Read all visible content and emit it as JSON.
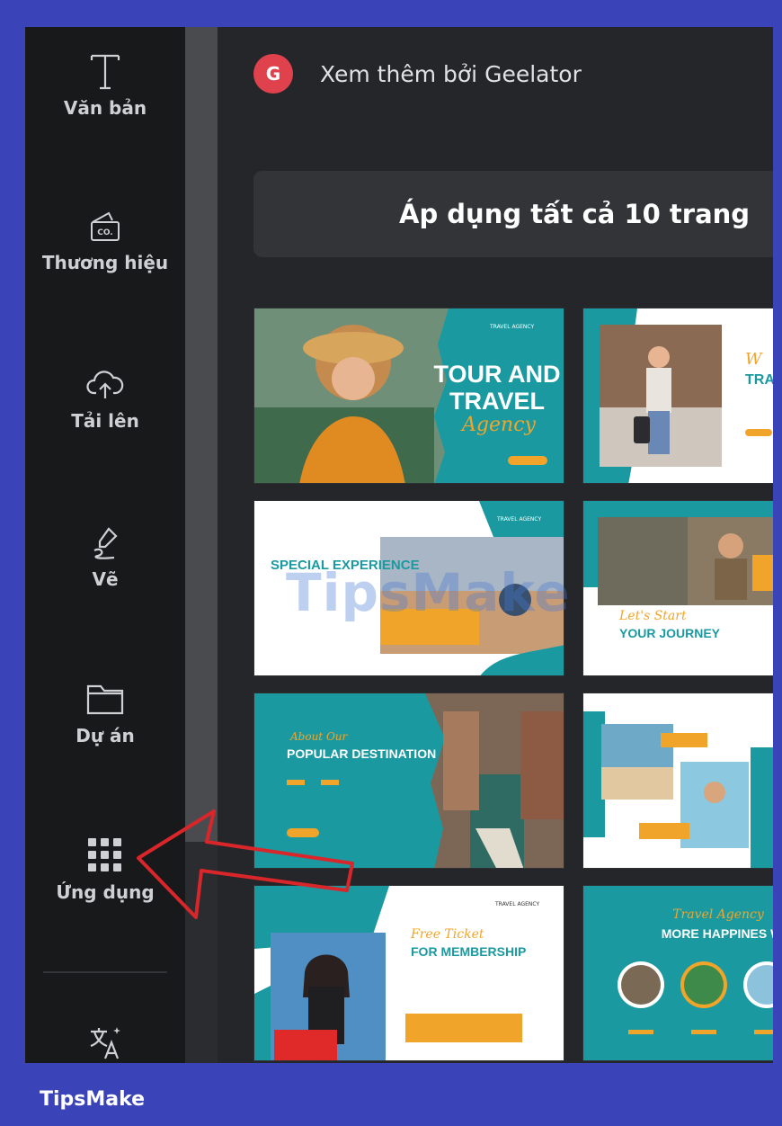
{
  "rail": {
    "items": [
      {
        "label": "Văn bản",
        "icon": "text-icon"
      },
      {
        "label": "Thương hiệu",
        "icon": "brand-icon"
      },
      {
        "label": "Tải lên",
        "icon": "upload-cloud-icon"
      },
      {
        "label": "Vẽ",
        "icon": "draw-icon"
      },
      {
        "label": "Dự án",
        "icon": "folder-icon"
      },
      {
        "label": "Ứng dụng",
        "icon": "apps-grid-icon"
      }
    ],
    "bottom_icon": "translate-icon",
    "brand_badge": "CO."
  },
  "panel": {
    "author": {
      "initial": "G",
      "text": "Xem thêm bởi Geelator"
    },
    "apply_button": "Áp dụng tất cả 10 trang"
  },
  "templates": [
    {
      "title": "TOUR AND",
      "title2": "TRAVEL",
      "script": "Agency",
      "header": "TRAVEL AGENCY"
    },
    {
      "title": "TRAV",
      "script": "W"
    },
    {
      "title": "SPECIAL EXPERIENCE",
      "header": "TRAVEL AGENCY"
    },
    {
      "title": "YOUR JOURNEY",
      "script": "Let's Start"
    },
    {
      "title": "POPULAR DESTINATION",
      "script": "About Our"
    },
    {
      "title": "",
      "script": ""
    },
    {
      "title": "FOR MEMBERSHIP",
      "script": "Free Ticket",
      "header": "TRAVEL AGENCY"
    },
    {
      "title": "MORE HAPPINES WI",
      "script": "Travel Agency"
    }
  ],
  "watermark": "TipsMake",
  "footer": {
    "brand": "TipsMake"
  },
  "colors": {
    "teal": "#1a9aa0",
    "orange": "#f0a52a",
    "accent_red": "#e0424d",
    "arrow_red": "#d8262a",
    "frame_blue": "#3a43b8"
  }
}
